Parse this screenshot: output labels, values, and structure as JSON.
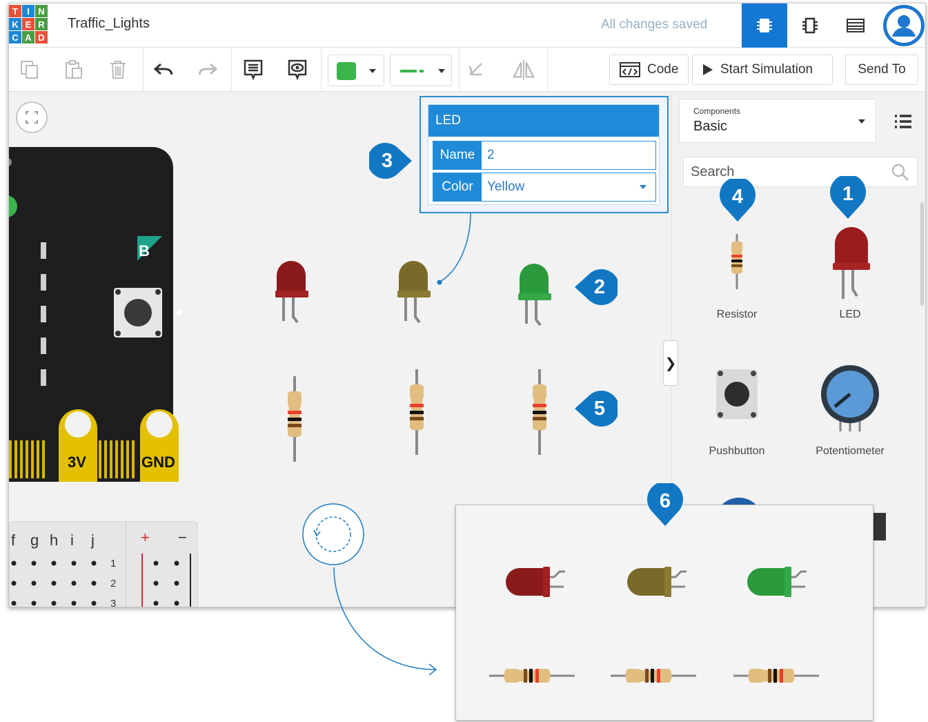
{
  "app": {
    "logo_letters": [
      "T",
      "I",
      "N",
      "K",
      "E",
      "R",
      "C",
      "A",
      "D"
    ],
    "logo_colors": [
      "#e8523a",
      "#1e88d6",
      "#4a9c44",
      "#1e88d6",
      "#e8523a",
      "#4a9c44",
      "#1e88d6",
      "#4a9c44",
      "#e8523a"
    ],
    "title": "Traffic_Lights",
    "save_status": "All changes saved",
    "accent": "#1477d4"
  },
  "toolbar": {
    "icons": [
      "copy-icon",
      "paste-icon",
      "delete-icon",
      "undo-icon",
      "redo-icon",
      "notes-icon",
      "notes-visibility-icon"
    ],
    "fill_color": "#3ab54a",
    "wire_color": "#3ab54a",
    "code_label": "Code",
    "start_simulation_label": "Start Simulation",
    "send_to_label": "Send To"
  },
  "board": {
    "button_label": "B",
    "pin_3v": "3V",
    "pin_gnd": "GND"
  },
  "breadboard": {
    "columns": [
      "f",
      "g",
      "h",
      "i",
      "j"
    ],
    "rows": [
      "1",
      "2",
      "3"
    ],
    "plus": "+",
    "minus": "−"
  },
  "inspector": {
    "title": "LED",
    "name_label": "Name",
    "name_value": "2",
    "color_label": "Color",
    "color_value": "Yellow"
  },
  "components_panel": {
    "dropdown_label": "Components",
    "dropdown_value": "Basic",
    "search_placeholder": "Search",
    "items": [
      {
        "label": "Resistor"
      },
      {
        "label": "LED"
      },
      {
        "label": "Pushbutton"
      },
      {
        "label": "Potentiometer"
      }
    ],
    "collapse_glyph": "❯"
  },
  "canvas": {
    "leds": [
      {
        "color": "#8b1a1a"
      },
      {
        "color": "#7a6a2a"
      },
      {
        "color": "#2a9a3c"
      }
    ]
  },
  "callouts": [
    "1",
    "2",
    "3",
    "4",
    "5",
    "6"
  ],
  "callout_color": "#1177c2"
}
